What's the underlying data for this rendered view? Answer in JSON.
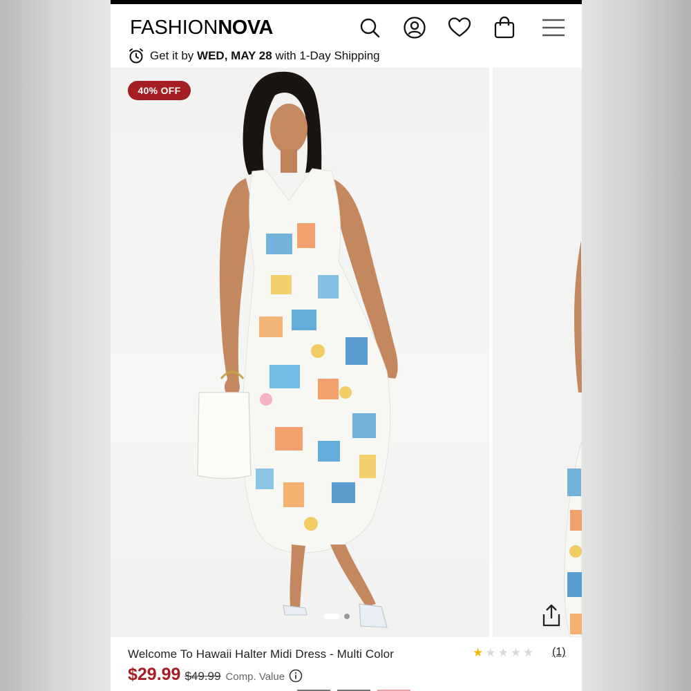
{
  "header": {
    "logo_part1": "FASHION",
    "logo_part2": "NOVA",
    "icons": [
      "search-icon",
      "account-icon",
      "heart-icon",
      "bag-icon",
      "menu-icon"
    ]
  },
  "shipping": {
    "prefix": "Get it by",
    "date": "WED, MAY 28",
    "suffix": "with 1-Day Shipping"
  },
  "gallery": {
    "badge": "40% OFF",
    "slide_count": 2,
    "active_slide": 1
  },
  "product": {
    "name": "Welcome To Hawaii Halter Midi Dress - Multi Color",
    "sale_price": "$29.99",
    "original_price": "$49.99",
    "comp_label": "Comp. Value",
    "rating": 1,
    "rating_max": 5,
    "review_count": "(1)"
  },
  "colors": {
    "accent": "#a51e23",
    "star_filled": "#f2b705",
    "star_empty": "#d9d9d9"
  }
}
